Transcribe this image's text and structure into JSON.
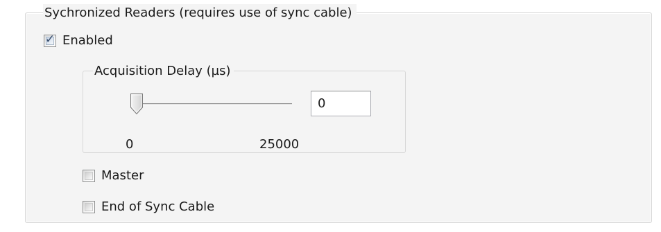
{
  "sync_group": {
    "title": "Sychronized Readers (requires use of sync cable)",
    "enabled": {
      "label": "Enabled",
      "checked": true
    }
  },
  "acquisition_delay": {
    "title": "Acquisition Delay (µs)",
    "value": "0",
    "min_label": "0",
    "max_label": "25000",
    "slider_level": 0
  },
  "options": {
    "master": {
      "label": "Master",
      "checked": false
    },
    "end_of_sync_cable": {
      "label": "End of Sync Cable",
      "checked": false
    }
  }
}
